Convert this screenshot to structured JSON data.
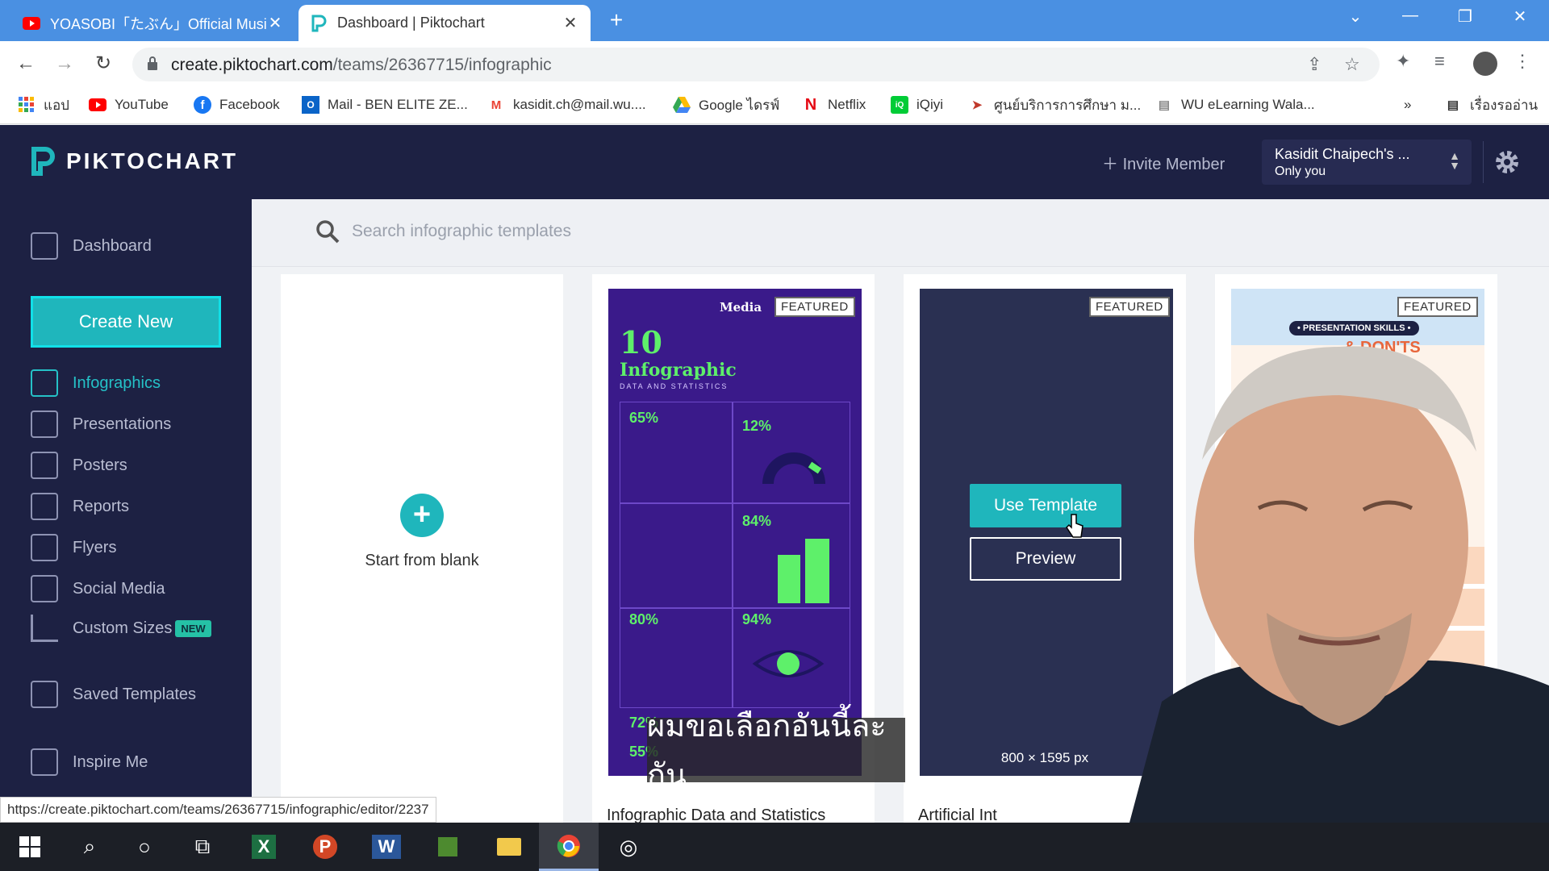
{
  "browser": {
    "tabs": [
      {
        "title": "YOASOBI「たぶん」Official Music V",
        "active": false
      },
      {
        "title": "Dashboard | Piktochart",
        "active": true
      }
    ],
    "url_host": "create.piktochart.com",
    "url_path": "/teams/26367715/infographic",
    "bookmarks": [
      {
        "label": "แอป",
        "icon": "apps-icon"
      },
      {
        "label": "YouTube",
        "icon": "youtube-icon"
      },
      {
        "label": "Facebook",
        "icon": "facebook-icon"
      },
      {
        "label": "Mail - BEN ELITE ZE...",
        "icon": "outlook-icon"
      },
      {
        "label": "kasidit.ch@mail.wu....",
        "icon": "gmail-icon"
      },
      {
        "label": "Google ไดรฟ์",
        "icon": "drive-icon"
      },
      {
        "label": "Netflix",
        "icon": "netflix-icon"
      },
      {
        "label": "iQiyi",
        "icon": "iqiyi-icon"
      },
      {
        "label": "ศูนย์บริการการศึกษา ม...",
        "icon": "edu-icon"
      },
      {
        "label": "WU eLearning Wala...",
        "icon": "elearning-icon"
      }
    ],
    "reading_list": "เรื่องรออ่าน",
    "status_url": "https://create.piktochart.com/teams/26367715/infographic/editor/2237"
  },
  "header": {
    "logo": "PIKTOCHART",
    "invite": "Invite Member",
    "team_name": "Kasidit Chaipech's ...",
    "team_scope": "Only you"
  },
  "sidebar": {
    "dashboard": "Dashboard",
    "create_new": "Create New",
    "items": [
      {
        "label": "Infographics",
        "active": true
      },
      {
        "label": "Presentations",
        "active": false
      },
      {
        "label": "Posters",
        "active": false
      },
      {
        "label": "Reports",
        "active": false
      },
      {
        "label": "Flyers",
        "active": false
      },
      {
        "label": "Social Media",
        "active": false
      },
      {
        "label": "Custom Sizes",
        "active": false
      }
    ],
    "new_badge": "NEW",
    "saved_templates": "Saved Templates",
    "inspire_me": "Inspire Me"
  },
  "main": {
    "search_placeholder": "Search infographic templates",
    "blank_label": "Start from blank",
    "featured": "FEATURED",
    "cards": [
      {
        "title": "Infographic Data and Statistics"
      },
      {
        "title": "Artificial Int"
      }
    ],
    "use_template": "Use Template",
    "preview": "Preview",
    "dimensions": "800 × 1595 px",
    "thumb_texts": {
      "media": "Media",
      "headline1": "10",
      "headline2": "Infographic",
      "subhead": "DATA AND STATISTICS",
      "stats": [
        "65%",
        "12%",
        "84%",
        "80%",
        "94%",
        "72%",
        "55%"
      ],
      "pres_label": "• PRESENTATION SKILLS •",
      "pres_title": "& DON'TS"
    }
  },
  "overlay": {
    "subtitle": "ผมขอเลือกอันนี้ละกัน"
  },
  "colors": {
    "brand_dark": "#1d2143",
    "accent_teal": "#1fb6bc",
    "chrome_blue": "#4a90e2"
  }
}
